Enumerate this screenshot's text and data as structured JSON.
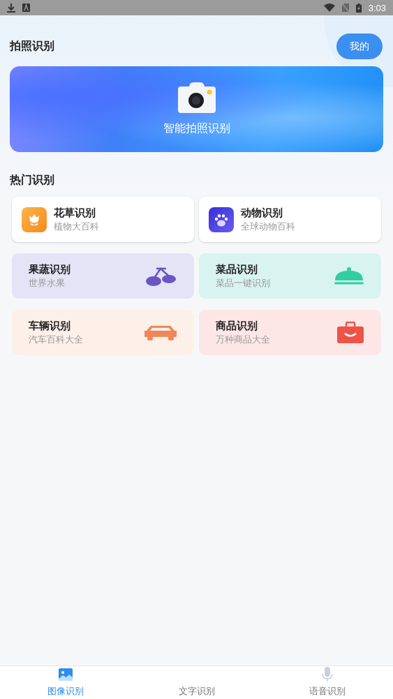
{
  "status_bar": {
    "time": "3:03"
  },
  "header": {
    "title": "拍照识别",
    "profile_button": "我的"
  },
  "banner": {
    "label": "智能拍照识别"
  },
  "hot": {
    "title": "热门识别",
    "cards": [
      {
        "kind": "plain",
        "title": "花草识别",
        "subtitle": "植物大百科"
      },
      {
        "kind": "plain",
        "title": "动物识别",
        "subtitle": "全球动物百科"
      },
      {
        "kind": "tinted",
        "title": "果蔬识别",
        "subtitle": "世界水果"
      },
      {
        "kind": "tinted",
        "title": "菜品识别",
        "subtitle": "菜品一键识别"
      },
      {
        "kind": "tinted",
        "title": "车辆识别",
        "subtitle": "汽车百科大全"
      },
      {
        "kind": "tinted",
        "title": "商品识别",
        "subtitle": "万种商品大全"
      }
    ]
  },
  "bottom_nav": [
    {
      "label": "图像识别",
      "selected": true
    },
    {
      "label": "文字识别",
      "selected": false
    },
    {
      "label": "语音识别",
      "selected": false
    }
  ]
}
